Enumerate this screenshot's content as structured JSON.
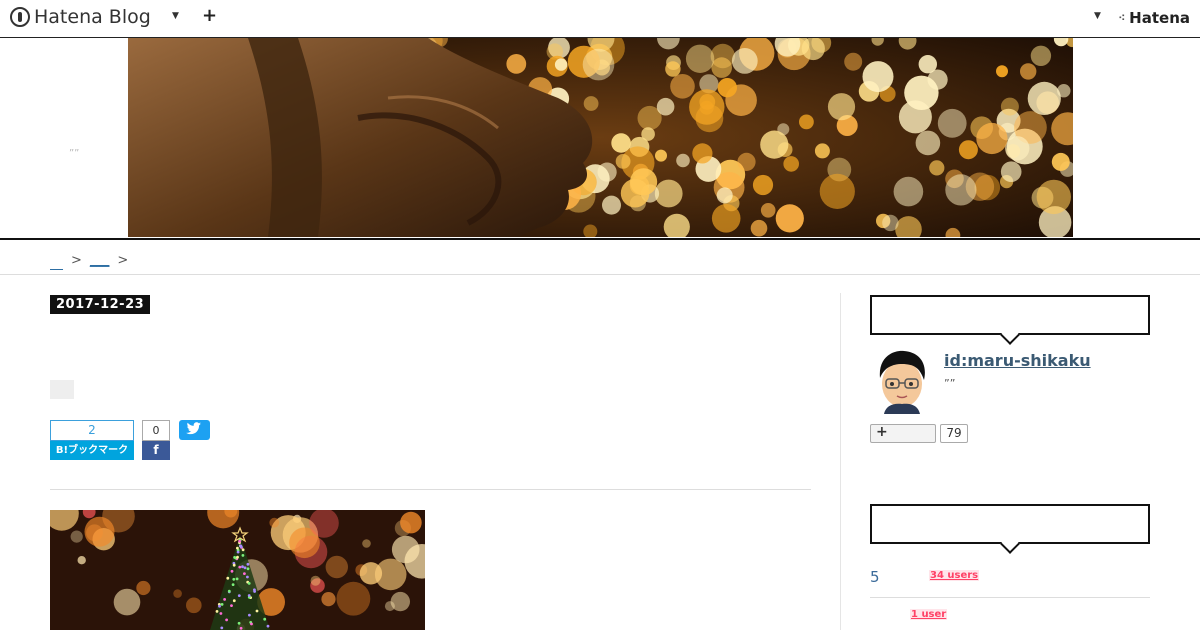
{
  "topbar": {
    "logo_text": "Hatena Blog",
    "right_brand": "Hatena",
    "icons": [
      "hatena-blog-logo-icon",
      "dropdown-caret-icon",
      "plus-icon",
      "hatena-mark-icon"
    ]
  },
  "header": {
    "blog_title": "””"
  },
  "breadcrumb": {
    "items": [
      "　",
      "___"
    ],
    "separator": ">"
  },
  "entry": {
    "date": "2017-12-23",
    "bookmark_count": "2",
    "bookmark_label": "B!ブックマーク",
    "facebook_count": "0",
    "facebook_label": "f"
  },
  "sidebar": {
    "profile": {
      "id": "id:maru-shikaku",
      "description": "””",
      "follow_count": "79"
    },
    "ranking": [
      {
        "rank": "5",
        "users": "34 users"
      },
      {
        "rank": "",
        "users": "1 user"
      }
    ]
  },
  "colors": {
    "bookmark_blue": "#00a4de",
    "facebook_blue": "#3b5998",
    "twitter_blue": "#1da1f2",
    "users_red": "#ff4166"
  }
}
